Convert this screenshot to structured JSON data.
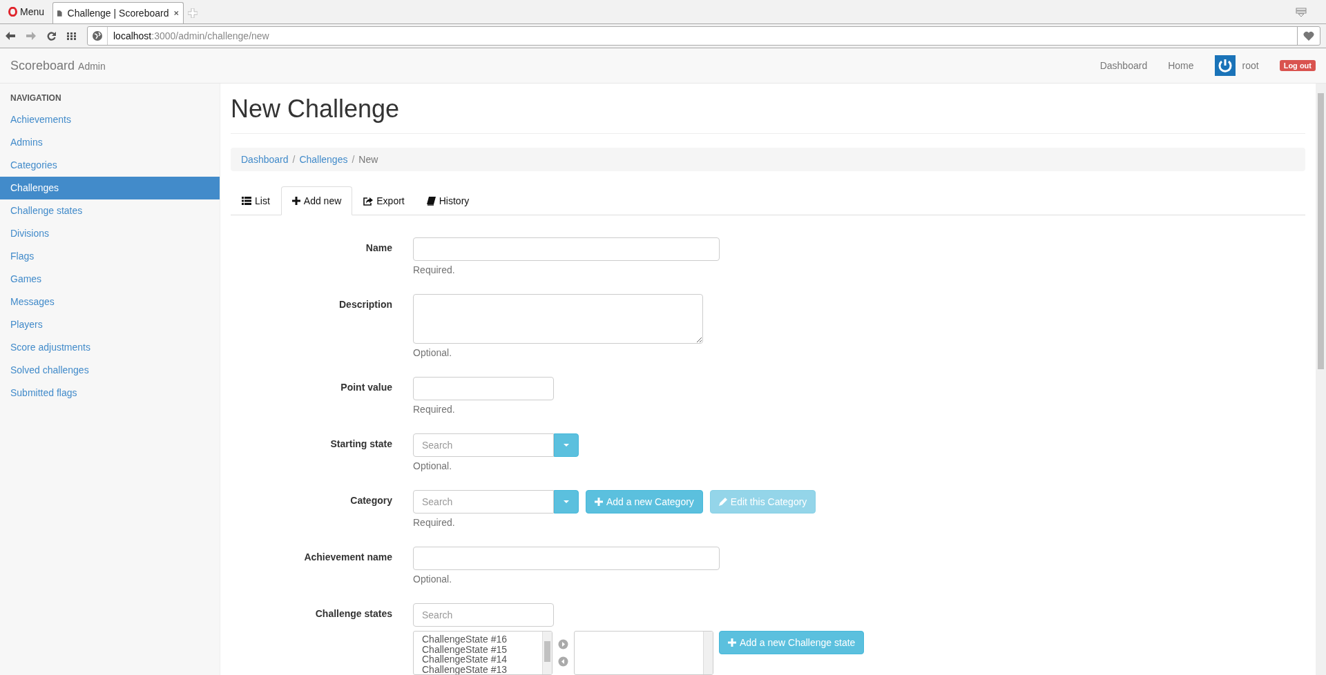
{
  "browser": {
    "menu": "Menu",
    "tab_title": "Challenge | Scoreboard",
    "url_host": "localhost",
    "url_path": ":3000/admin/challenge/new"
  },
  "navbar": {
    "brand": "Scoreboard",
    "brand_sub": "Admin",
    "links": [
      "Dashboard",
      "Home"
    ],
    "user": "root",
    "logout": "Log out"
  },
  "sidebar": {
    "heading": "NAVIGATION",
    "items": [
      {
        "label": "Achievements",
        "selected": false
      },
      {
        "label": "Admins",
        "selected": false
      },
      {
        "label": "Categories",
        "selected": false
      },
      {
        "label": "Challenges",
        "selected": true
      },
      {
        "label": "Challenge states",
        "selected": false
      },
      {
        "label": "Divisions",
        "selected": false
      },
      {
        "label": "Flags",
        "selected": false
      },
      {
        "label": "Games",
        "selected": false
      },
      {
        "label": "Messages",
        "selected": false
      },
      {
        "label": "Players",
        "selected": false
      },
      {
        "label": "Score adjustments",
        "selected": false
      },
      {
        "label": "Solved challenges",
        "selected": false
      },
      {
        "label": "Submitted flags",
        "selected": false
      }
    ]
  },
  "page": {
    "title": "New Challenge",
    "breadcrumb_separator": "/",
    "breadcrumb": [
      {
        "label": "Dashboard",
        "kind": "link"
      },
      {
        "label": "Challenges",
        "kind": "link"
      },
      {
        "label": "New",
        "kind": "current"
      }
    ],
    "tabs": [
      {
        "label": "List",
        "kind": "list",
        "selected": false
      },
      {
        "label": "Add new",
        "kind": "add",
        "selected": true
      },
      {
        "label": "Export",
        "kind": "export",
        "selected": false
      },
      {
        "label": "History",
        "kind": "history",
        "selected": false
      }
    ]
  },
  "form": {
    "fields": [
      {
        "kind": "text",
        "label": "Name",
        "help": "Required."
      },
      {
        "kind": "textarea",
        "label": "Description",
        "help": "Optional."
      },
      {
        "kind": "short",
        "label": "Point value",
        "help": "Required."
      },
      {
        "kind": "combo",
        "label": "Starting state",
        "placeholder": "Search",
        "help": "Optional."
      },
      {
        "kind": "combo",
        "label": "Category",
        "placeholder": "Search",
        "help": "Required.",
        "buttons": [
          {
            "label": "Add a new Category",
            "kind": "add",
            "disabled": false
          },
          {
            "label": "Edit this Category",
            "kind": "edit",
            "disabled": true
          }
        ]
      },
      {
        "kind": "text",
        "label": "Achievement name",
        "help": "Optional."
      },
      {
        "kind": "dual",
        "label": "Challenge states",
        "placeholder": "Search",
        "options": [
          "ChallengeState #16",
          "ChallengeState #15",
          "ChallengeState #14",
          "ChallengeState #13"
        ],
        "buttons": [
          {
            "label": "Add a new Challenge state",
            "kind": "add",
            "disabled": false
          }
        ]
      }
    ]
  }
}
